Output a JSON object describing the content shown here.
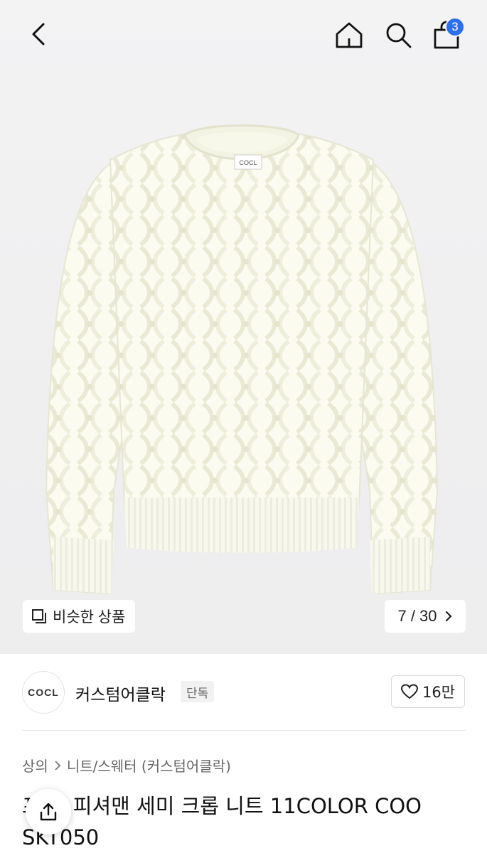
{
  "header": {
    "back_icon": "chevron-left-icon",
    "home_icon": "home-icon",
    "search_icon": "search-icon",
    "cart_icon": "shopping-bag-icon",
    "cart_count": "3",
    "badge_color": "#2f6fe8"
  },
  "gallery": {
    "image": "cream cable-knit sweater",
    "label_text": "COCL",
    "similar_label": "비슷한 상품",
    "pager_text": "7 / 30",
    "current_index": 7,
    "total": 30
  },
  "brand": {
    "logo_text": "COCL",
    "name": "커스텀어클락",
    "tag": "단독",
    "like_count": "16만"
  },
  "breadcrumb": {
    "items": [
      "상의",
      "니트/스웨터 (커스텀어클락)"
    ]
  },
  "product": {
    "title_line1": "프 드 피셔맨 세미 크롭 니트 11COLOR COO",
    "title_line2": "SKT050"
  }
}
